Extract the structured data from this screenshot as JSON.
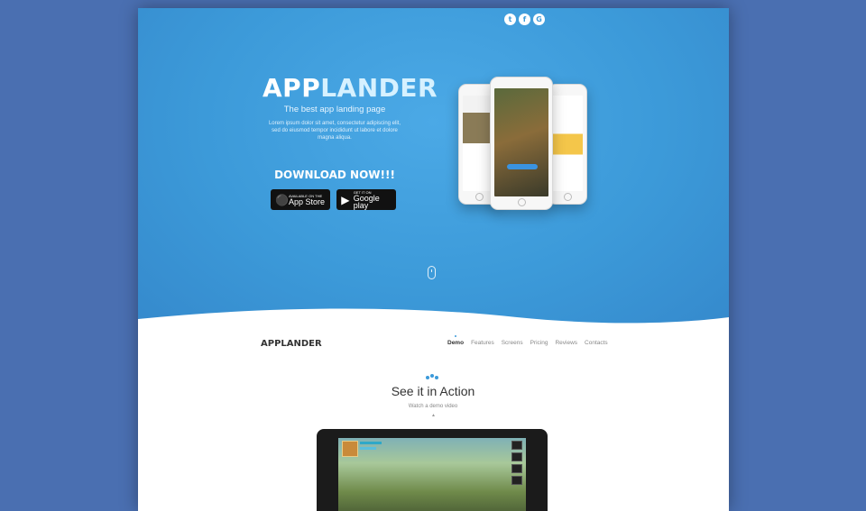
{
  "socials": [
    {
      "name": "twitter",
      "glyph": "t"
    },
    {
      "name": "facebook",
      "glyph": "f"
    },
    {
      "name": "google",
      "glyph": "G"
    }
  ],
  "hero": {
    "title_part1": "APP",
    "title_part2": "LANDER",
    "tagline": "The best app landing page",
    "intro": "Lorem ipsum dolor sit amet, consectetur adipiscing elit, sed do eiusmod tempor incididunt ut labore et dolore magna aliqua.",
    "download_title": "DOWNLOAD NOW!!!",
    "app_store": {
      "small": "AVAILABLE ON THE",
      "big": "App Store"
    },
    "google_play": {
      "small": "GET IT ON",
      "big": "Google play"
    }
  },
  "nav": {
    "logo": "APPLANDER",
    "items": [
      "Demo",
      "Features",
      "Screens",
      "Pricing",
      "Reviews",
      "Contacts"
    ],
    "active_index": 0
  },
  "demo": {
    "title": "See it in Action",
    "subtitle": "Watch a demo video"
  },
  "colors": {
    "background": "#4a6fb1",
    "hero": "#3c9ad9",
    "accent": "#3c9ad9"
  }
}
